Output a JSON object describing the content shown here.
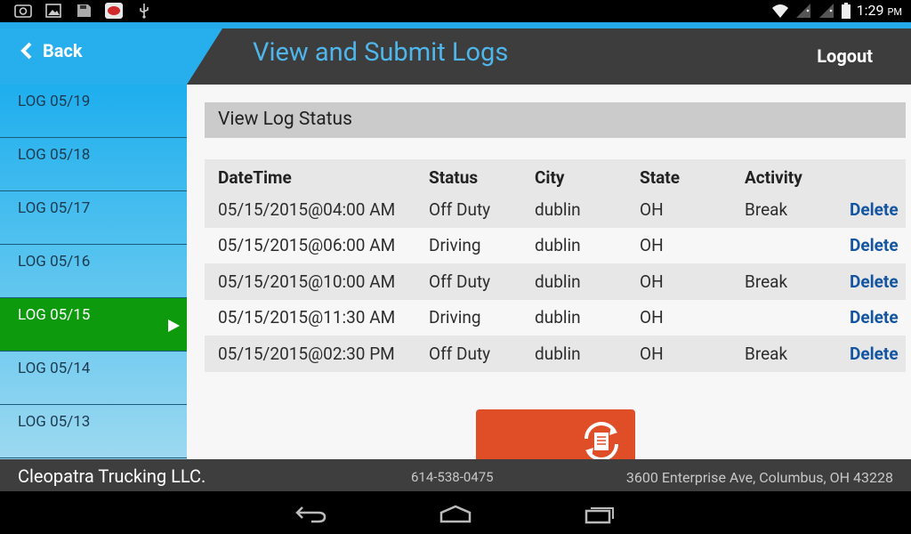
{
  "status_bar": {
    "left_icons": [
      "screenshot-icon",
      "gallery-icon",
      "save-icon",
      "app-icon",
      "usb-icon"
    ],
    "right_icons": [
      "wifi-icon",
      "signal-icon",
      "signal-icon",
      "battery-icon"
    ],
    "time": "1:29",
    "ampm": "PM"
  },
  "header": {
    "back_label": "Back",
    "title": "View and Submit Logs",
    "logout_label": "Logout"
  },
  "sidebar": {
    "items": [
      {
        "label": "LOG 05/19"
      },
      {
        "label": "LOG 05/18"
      },
      {
        "label": "LOG 05/17"
      },
      {
        "label": "LOG 05/16"
      },
      {
        "label": "LOG 05/15",
        "active": true
      },
      {
        "label": "LOG 05/14"
      },
      {
        "label": "LOG 05/13"
      }
    ]
  },
  "main": {
    "section_title": "View Log Status",
    "columns": [
      "DateTime",
      "Status",
      "City",
      "State",
      "Activity",
      ""
    ],
    "rows": [
      {
        "datetime": "05/15/2015@04:00 AM",
        "status": "Off Duty",
        "city": "dublin",
        "state": "OH",
        "activity": "Break",
        "action": "Delete"
      },
      {
        "datetime": "05/15/2015@06:00 AM",
        "status": "Driving",
        "city": "dublin",
        "state": "OH",
        "activity": "",
        "action": "Delete"
      },
      {
        "datetime": "05/15/2015@10:00 AM",
        "status": "Off Duty",
        "city": "dublin",
        "state": "OH",
        "activity": "Break",
        "action": "Delete"
      },
      {
        "datetime": "05/15/2015@11:30 AM",
        "status": "Driving",
        "city": "dublin",
        "state": "OH",
        "activity": "",
        "action": "Delete"
      },
      {
        "datetime": "05/15/2015@02:30 PM",
        "status": "Off Duty",
        "city": "dublin",
        "state": "OH",
        "activity": "Break",
        "action": "Delete"
      }
    ],
    "submit_icon": "sync-document-icon"
  },
  "footer": {
    "company": "Cleopatra Trucking LLC.",
    "phone": "614-538-0475",
    "address": "3600 Enterprise Ave, Columbus, OH 43228"
  },
  "nav_bar": {
    "icons": [
      "back-nav-icon",
      "home-nav-icon",
      "recent-apps-icon"
    ]
  },
  "colors": {
    "accent_blue": "#24a9e9",
    "title_blue": "#4eb6ea",
    "active_green": "#0d9b0d",
    "delete_blue": "#1455a2",
    "submit_orange": "#e04e27"
  }
}
